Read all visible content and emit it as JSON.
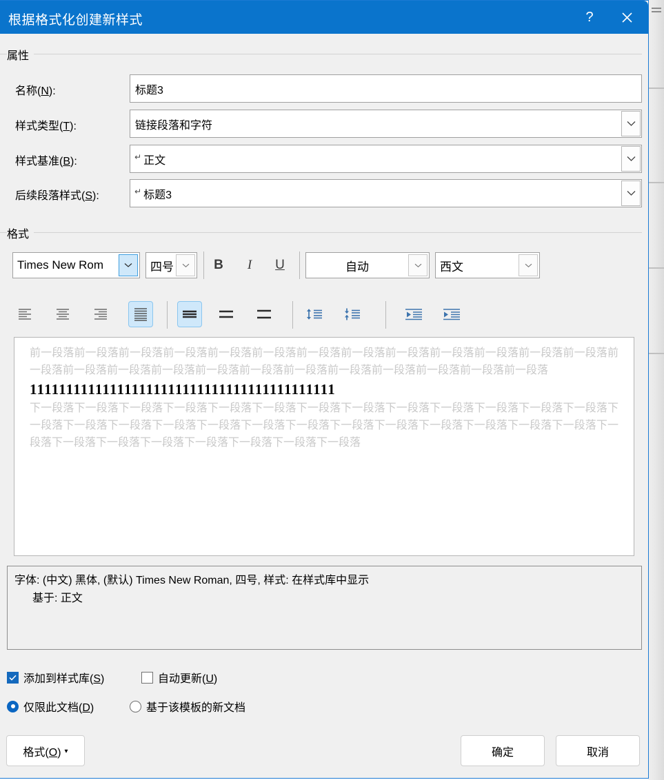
{
  "window": {
    "title": "根据格式化创建新样式",
    "help_label": "?",
    "close_label": "✕"
  },
  "properties": {
    "group_label": "属性",
    "rows": [
      {
        "label_pre": "名称(",
        "label_key": "N",
        "label_post": "):",
        "value": "标题3",
        "prefix": "",
        "has_dropdown": false
      },
      {
        "label_pre": "样式类型(",
        "label_key": "T",
        "label_post": "):",
        "value": "链接段落和字符",
        "prefix": "",
        "has_dropdown": true
      },
      {
        "label_pre": "样式基准(",
        "label_key": "B",
        "label_post": "):",
        "value": "正文",
        "prefix": "↵",
        "has_dropdown": true
      },
      {
        "label_pre": "后续段落样式(",
        "label_key": "S",
        "label_post": "):",
        "value": "标题3",
        "prefix": "↵",
        "has_dropdown": true
      }
    ]
  },
  "format": {
    "group_label": "格式",
    "font_name": "Times New Rom",
    "font_size": "四号",
    "bold_label": "B",
    "italic_label": "I",
    "underline_label": "U",
    "color_value": "自动",
    "script_value": "西文",
    "toolbar": {
      "align_left": "align-left",
      "align_center": "align-center",
      "align_right": "align-right",
      "align_justify": "align-justify",
      "spacing_single": "line-spacing-single",
      "spacing_1_5": "line-spacing-1.5",
      "spacing_double": "line-spacing-double",
      "spacing_increase": "increase-paragraph-spacing",
      "spacing_decrease": "decrease-paragraph-spacing",
      "indent_decrease": "decrease-indent",
      "indent_increase": "increase-indent"
    }
  },
  "preview": {
    "prev_paragraph": "前一段落前一段落前一段落前一段落前一段落前一段落前一段落前一段落前一段落前一段落前一段落前一段落前一段落前一段落前一段落前一段落前一段落前一段落前一段落前一段落前一段落前一段落前一段落前一段落前一段落",
    "sample_text": "111111111111111111111111111111111111111111",
    "next_paragraph": "下一段落下一段落下一段落下一段落下一段落下一段落下一段落下一段落下一段落下一段落下一段落下一段落下一段落下一段落下一段落下一段落下一段落下一段落下一段落下一段落下一段落下一段落下一段落下一段落下一段落下一段落下一段落下一段落下一段落下一段落下一段落下一段落下一段落下一段落"
  },
  "description": {
    "line1": "字体: (中文) 黑体, (默认) Times New Roman, 四号, 样式: 在样式库中显示",
    "line2": "基于: 正文"
  },
  "options": {
    "add_to_gallery": {
      "pre": "添加到样式库(",
      "key": "S",
      "post": ")",
      "checked": true
    },
    "auto_update": {
      "pre": "自动更新(",
      "key": "U",
      "post": ")",
      "checked": false
    },
    "this_doc_only": {
      "pre": "仅限此文档(",
      "key": "D",
      "post": ")",
      "selected": true
    },
    "new_docs_template": {
      "pre": "基于该模板的新文档",
      "key": "",
      "post": "",
      "selected": false
    }
  },
  "footer": {
    "format_pre": "格式(",
    "format_key": "O",
    "format_post": ")",
    "format_caret": "▾",
    "ok_label": "确定",
    "cancel_label": "取消"
  },
  "colors": {
    "title_bar": "#0a74cc",
    "accent": "#1469bd",
    "highlight": "#cfe8fa",
    "dialog_bg": "#f0f0f0"
  }
}
